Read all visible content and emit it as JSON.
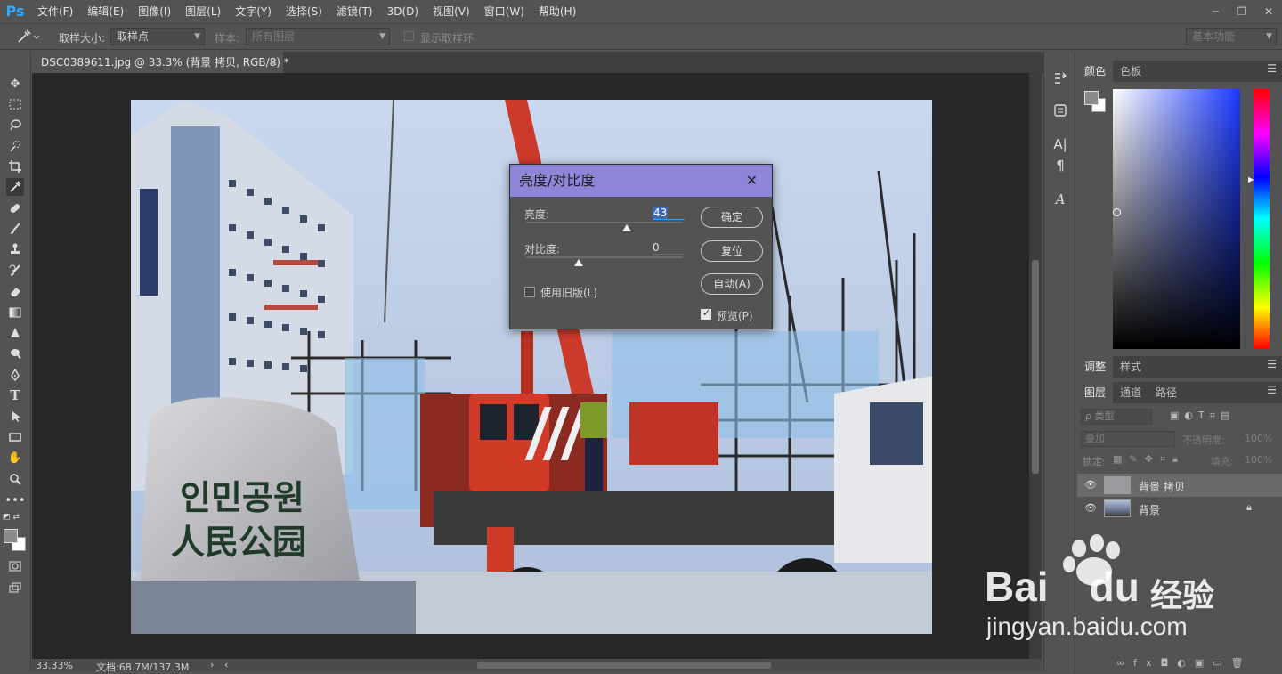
{
  "app": {
    "logo": "Ps",
    "menu": [
      "文件(F)",
      "编辑(E)",
      "图像(I)",
      "图层(L)",
      "文字(Y)",
      "选择(S)",
      "滤镜(T)",
      "3D(D)",
      "视图(V)",
      "窗口(W)",
      "帮助(H)"
    ],
    "window_controls": [
      "─",
      "❐",
      "✕"
    ]
  },
  "options_bar": {
    "sample_size_label": "取样大小:",
    "sample_size_value": "取样点",
    "sample_label": "样本:",
    "sample_value": "所有图层",
    "show_ring_label": "显示取样环",
    "workspace": "基本功能"
  },
  "document": {
    "tab_title": "DSC0389611.jpg @ 33.3% (背景 拷贝, RGB/8) *",
    "tab_close": "×",
    "zoom": "33.33%",
    "doc_info": "文档:68.7M/137.3M"
  },
  "photo": {
    "stone_korean": "인민공원",
    "stone_chinese": "人民公园"
  },
  "dialog": {
    "title": "亮度/对比度",
    "brightness_label": "亮度:",
    "brightness_value": "43",
    "brightness": 43,
    "contrast_label": "对比度:",
    "contrast_value": "0",
    "contrast": 0,
    "legacy_label": "使用旧版(L)",
    "legacy_checked": false,
    "preview_label": "预览(P)",
    "preview_checked": true,
    "ok": "确定",
    "reset": "复位",
    "auto": "自动(A)",
    "close": "✕"
  },
  "panels": {
    "color_tab": "颜色",
    "swatches_tab": "色板",
    "adjust_tab": "调整",
    "styles_tab": "样式",
    "layers_tab": "图层",
    "channels_tab": "通道",
    "paths_tab": "路径",
    "filter_kind": "ρ 类型",
    "blend_mode": "叠加",
    "opacity_label": "不透明度:",
    "opacity_value": "100%",
    "lock_label": "锁定:",
    "fill_label": "填充:",
    "fill_value": "100%",
    "layers": [
      {
        "name": "背景 拷贝",
        "selected": true,
        "locked": false
      },
      {
        "name": "背景",
        "selected": false,
        "locked": true
      }
    ]
  },
  "watermark": {
    "brand": "Bai",
    "brand2": "du",
    "suffix": "经验",
    "url": "jingyan.baidu.com"
  }
}
